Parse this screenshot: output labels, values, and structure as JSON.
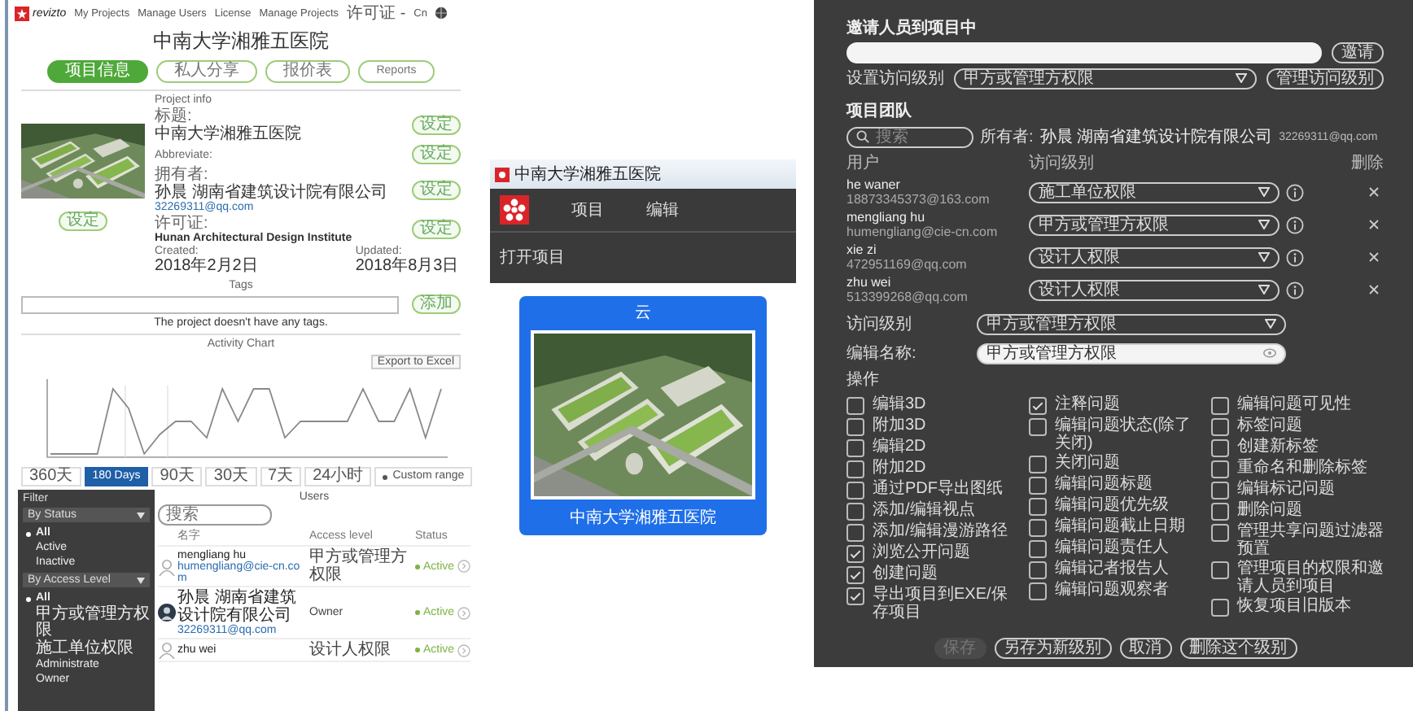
{
  "web_app": {
    "nav": {
      "logo": "revizto",
      "links": [
        "My Projects",
        "Manage Users",
        "License",
        "Manage Projects",
        "许可证 -"
      ],
      "language": "Cn"
    },
    "title": "中南大学湘雅五医院",
    "tabs": [
      {
        "label": "项目信息",
        "selected": true
      },
      {
        "label": "私人分享",
        "selected": false
      },
      {
        "label": "报价表",
        "selected": false
      },
      {
        "label": "Reports",
        "selected": false
      }
    ],
    "project_info": {
      "heading": "Project info",
      "image_button": "设定",
      "fields": [
        {
          "label": "标题:",
          "value": "中南大学湘雅五医院",
          "button": "设定"
        },
        {
          "label": "Abbreviate:",
          "button": "设定"
        },
        {
          "label": "拥有者:",
          "value": "孙晨 湖南省建筑设计院有限公司",
          "link": "32269311@qq.com",
          "button": "设定"
        },
        {
          "label": "许可证:",
          "value": "Hunan Architectural Design Institute",
          "button": "设定"
        }
      ],
      "dates": [
        {
          "label": "Created:",
          "value": "2018年2月2日"
        },
        {
          "label": "Updated:",
          "value": "2018年8月3日"
        }
      ]
    },
    "tags": {
      "title": "Tags",
      "add_button": "添加",
      "empty_message": "The project doesn't have any tags."
    },
    "activity": {
      "title": "Activity Chart",
      "export_button": "Export to Excel",
      "ranges": [
        {
          "label": "360天",
          "kind": "preset",
          "selected": false
        },
        {
          "label": "180 Days",
          "kind": "preset",
          "selected": true
        },
        {
          "label": "90天",
          "kind": "preset",
          "selected": false
        },
        {
          "label": "30天",
          "kind": "preset",
          "selected": false
        },
        {
          "label": "7天",
          "kind": "preset",
          "selected": false
        },
        {
          "label": "24小时",
          "kind": "preset",
          "selected": false
        },
        {
          "label": "Custom range",
          "kind": "custom",
          "selected": false
        }
      ]
    },
    "filter": {
      "title": "Filter",
      "groups": [
        {
          "label": "By Status",
          "items": [
            {
              "label": "All",
              "selected": true
            },
            {
              "label": "Active",
              "selected": false
            },
            {
              "label": "Inactive",
              "selected": false
            }
          ]
        },
        {
          "label": "By Access Level",
          "items": [
            {
              "label": "All",
              "selected": true
            },
            {
              "label": "甲方或管理方权限",
              "selected": false
            },
            {
              "label": "施工单位权限",
              "selected": false
            },
            {
              "label": "Administrate",
              "selected": false
            },
            {
              "label": "Owner",
              "selected": false
            }
          ]
        }
      ]
    },
    "users": {
      "title": "Users",
      "search_placeholder": "搜索",
      "columns": [
        "名字",
        "Access level",
        "Status"
      ],
      "rows": [
        {
          "kind": "placeholder",
          "name": "mengliang hu",
          "email": "humengliang@cie-cn.com",
          "access": "甲方或管理方权限",
          "status": "Active"
        },
        {
          "name": "孙晨 湖南省建筑设计院有限公司",
          "email": "32269311@qq.com",
          "access": "Owner",
          "status": "Active"
        },
        {
          "kind": "placeholder",
          "name": "zhu wei",
          "access": "设计人权限",
          "status": "Active"
        }
      ]
    }
  },
  "desktop_app": {
    "window_title": "中南大学湘雅五医院",
    "menu": [
      "项目",
      "编辑"
    ],
    "menu_items": [
      "打开项目"
    ],
    "card": {
      "header": "云",
      "caption": "中南大学湘雅五医院"
    }
  },
  "invite_dialog": {
    "title": "邀请人员到项目中",
    "invite_button": "邀请",
    "access_label": "设置访问级别",
    "access_value": "甲方或管理方权限",
    "manage_button": "管理访问级别",
    "team_title": "项目团队",
    "search_placeholder": "搜索",
    "owner_label": "所有者:",
    "owner_name": "孙晨 湖南省建筑设计院有限公司",
    "owner_email": "32269311@qq.com",
    "columns": [
      "用户",
      "访问级别",
      "删除"
    ],
    "members": [
      {
        "name": "he waner",
        "email": "18873345373@163.com",
        "access": "施工单位权限"
      },
      {
        "name": "mengliang hu",
        "email": "humengliang@cie-cn.com",
        "access": "甲方或管理方权限"
      },
      {
        "name": "xie zi",
        "email": "472951169@qq.com",
        "access": "设计人权限"
      },
      {
        "name": "zhu wei",
        "email": "513399268@qq.com",
        "access": "设计人权限"
      }
    ],
    "level_label": "访问级别",
    "level_value": "甲方或管理方权限",
    "name_label": "编辑名称:",
    "name_value": "甲方或管理方权限",
    "actions_title": "操作",
    "permission_columns": [
      [
        {
          "label": "编辑3D",
          "checked": false
        },
        {
          "label": "附加3D",
          "checked": false
        },
        {
          "label": "编辑2D",
          "checked": false
        },
        {
          "label": "附加2D",
          "checked": false
        },
        {
          "label": "通过PDF导出图纸",
          "checked": false
        },
        {
          "label": "添加/编辑视点",
          "checked": false
        },
        {
          "label": "添加/编辑漫游路径",
          "checked": false
        },
        {
          "label": "浏览公开问题",
          "checked": true
        },
        {
          "label": "创建问题",
          "checked": true
        },
        {
          "label": "导出项目到EXE/保存项目",
          "checked": true
        }
      ],
      [
        {
          "label": "注释问题",
          "checked": true
        },
        {
          "label": "编辑问题状态(除了关闭)",
          "checked": false
        },
        {
          "label": "关闭问题",
          "checked": false
        },
        {
          "label": "编辑问题标题",
          "checked": false
        },
        {
          "label": "编辑问题优先级",
          "checked": false
        },
        {
          "label": "编辑问题截止日期",
          "checked": false
        },
        {
          "label": "编辑问题责任人",
          "checked": false
        },
        {
          "label": "编辑记者报告人",
          "checked": false
        },
        {
          "label": "编辑问题观察者",
          "checked": false
        }
      ],
      [
        {
          "label": "编辑问题可见性",
          "checked": false
        },
        {
          "label": "标签问题",
          "checked": false
        },
        {
          "label": "创建新标签",
          "checked": false
        },
        {
          "label": "重命名和删除标签",
          "checked": false
        },
        {
          "label": "编辑标记问题",
          "checked": false
        },
        {
          "label": "删除问题",
          "checked": false
        },
        {
          "label": "管理共享问题过滤器预置",
          "checked": false
        },
        {
          "label": "管理项目的权限和邀请人员到项目",
          "checked": false
        },
        {
          "label": "恢复项目旧版本",
          "checked": false
        }
      ]
    ],
    "buttons": [
      {
        "label": "保存",
        "disabled": true
      },
      {
        "label": "另存为新级别",
        "disabled": false
      },
      {
        "label": "取消",
        "disabled": false
      },
      {
        "label": "删除这个级别",
        "disabled": false
      }
    ]
  }
}
